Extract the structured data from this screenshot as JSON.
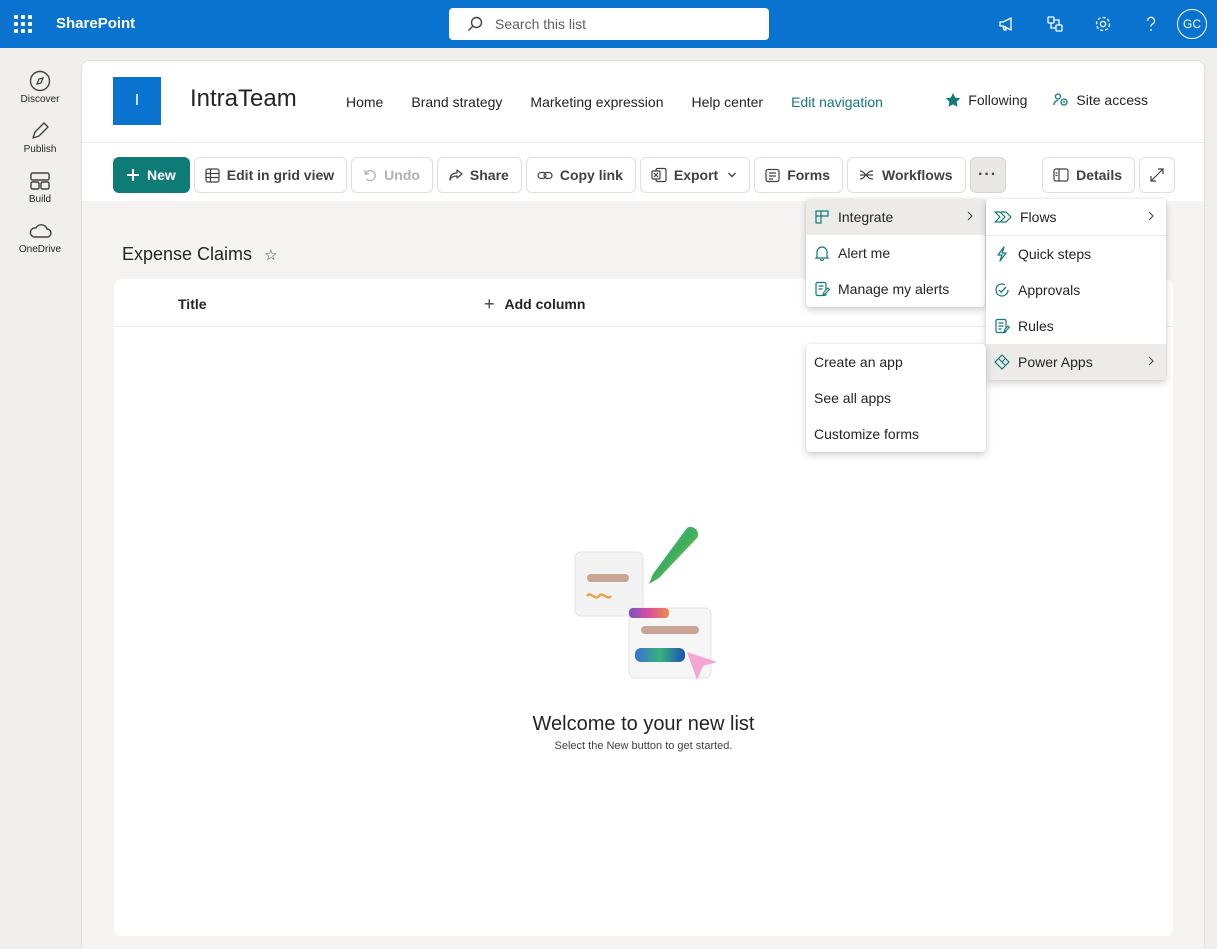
{
  "topbar": {
    "app_name": "SharePoint",
    "search_placeholder": "Search this list",
    "avatar_initials": "GC",
    "accent": "#0a73d0"
  },
  "rail": {
    "items": [
      {
        "label": "Discover",
        "icon": "compass-icon"
      },
      {
        "label": "Publish",
        "icon": "pen-icon"
      },
      {
        "label": "Build",
        "icon": "layout-icon"
      },
      {
        "label": "OneDrive",
        "icon": "cloud-icon"
      }
    ]
  },
  "site": {
    "logo_letter": "I",
    "title": "IntraTeam",
    "nav": [
      "Home",
      "Brand strategy",
      "Marketing expression",
      "Help center"
    ],
    "edit_nav": "Edit navigation",
    "following": "Following",
    "site_access": "Site access"
  },
  "commands": {
    "new": "New",
    "edit_grid": "Edit in grid view",
    "undo": "Undo",
    "share": "Share",
    "copy_link": "Copy link",
    "export": "Export",
    "forms": "Forms",
    "workflows": "Workflows",
    "more": "···",
    "details": "Details",
    "accent": "#0f7b77"
  },
  "list": {
    "title": "Expense Claims",
    "star": "☆",
    "col_title": "Title",
    "add_column": "Add column",
    "empty_title": "Welcome to your new list",
    "empty_sub": "Select the New button to get started."
  },
  "menus": {
    "more": [
      {
        "label": "Integrate",
        "icon": "integrate-icon",
        "submenu": true
      },
      {
        "label": "Alert me",
        "icon": "bell-icon"
      },
      {
        "label": "Manage my alerts",
        "icon": "alerts-edit-icon"
      }
    ],
    "integrate": [
      {
        "label": "Flows",
        "icon": "flow-icon",
        "submenu": true
      },
      {
        "label": "Quick steps",
        "icon": "lightning-icon"
      },
      {
        "label": "Approvals",
        "icon": "approvals-icon"
      },
      {
        "label": "Rules",
        "icon": "rules-icon"
      },
      {
        "label": "Power Apps",
        "icon": "power-apps-icon",
        "submenu": true
      }
    ],
    "power_apps": [
      {
        "label": "Create an app"
      },
      {
        "label": "See all apps"
      },
      {
        "label": "Customize forms"
      }
    ]
  }
}
